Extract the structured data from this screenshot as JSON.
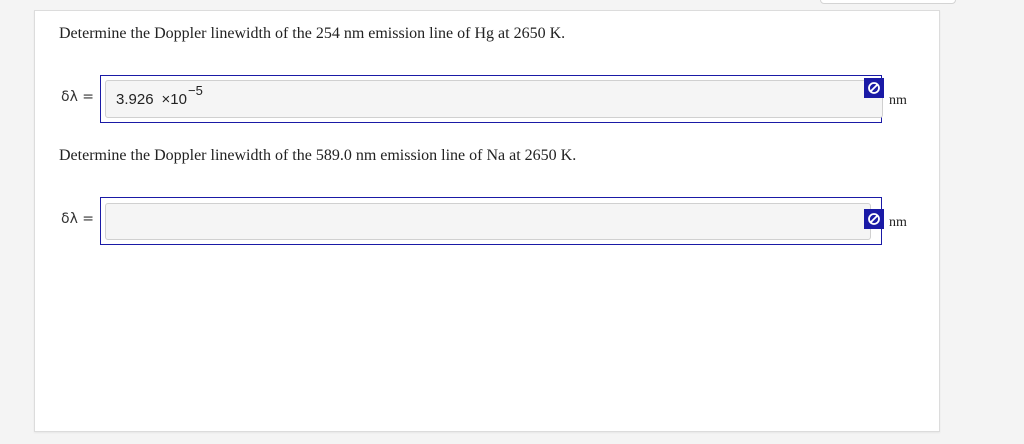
{
  "questions": [
    {
      "prompt": "Determine the Doppler linewidth of the 254 nm emission line of Hg at 2650 K.",
      "variable_label": "δλ =",
      "answer": {
        "mantissa": "3.926",
        "times": "×10",
        "exponent": "−5"
      },
      "unit": "nm",
      "status_icon": "no-entry-icon"
    },
    {
      "prompt": "Determine the Doppler linewidth of the 589.0 nm emission line of Na at 2650 K.",
      "variable_label": "δλ =",
      "answer": {
        "mantissa": "",
        "times": "",
        "exponent": ""
      },
      "unit": "nm",
      "status_icon": "no-entry-icon"
    }
  ],
  "colors": {
    "accent": "#1a1aa6",
    "input_background": "#f5f5f5",
    "page_background": "#f4f4f4"
  }
}
